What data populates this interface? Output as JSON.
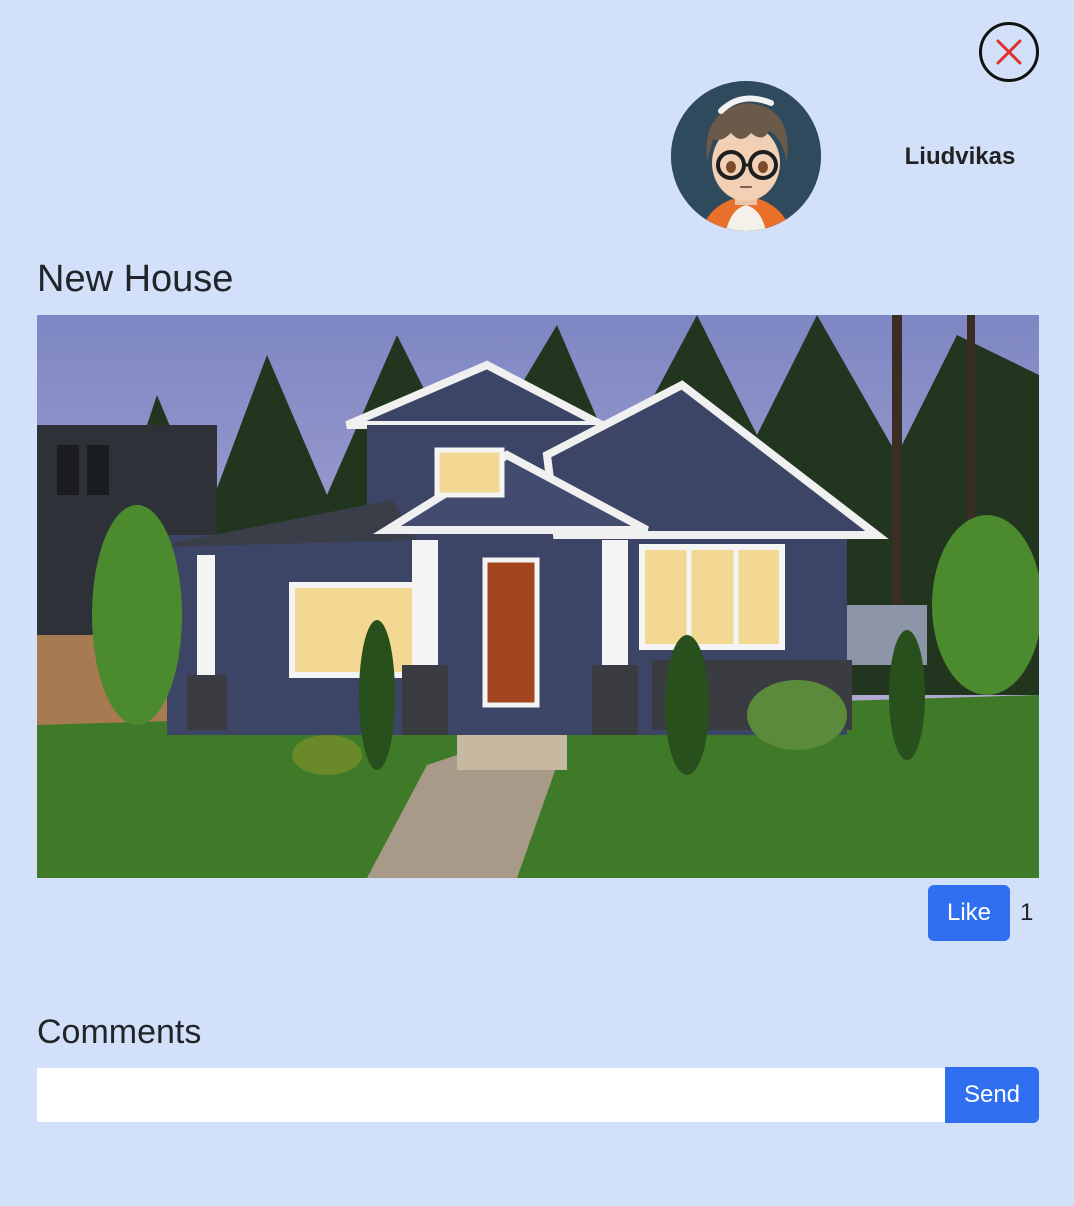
{
  "header": {
    "close_icon": "close-icon",
    "close_color": "#e0302a",
    "user": {
      "name": "Liudvikas",
      "avatar_icon": "avatar-anime-boy-glasses"
    }
  },
  "post": {
    "title": "New House",
    "image_subject": "house-photo",
    "like_label": "Like",
    "like_count": "1"
  },
  "comments": {
    "title": "Comments",
    "input_value": "",
    "input_placeholder": "",
    "send_label": "Send"
  },
  "colors": {
    "background": "#d3e0fa",
    "primary": "#2f6ff0"
  }
}
